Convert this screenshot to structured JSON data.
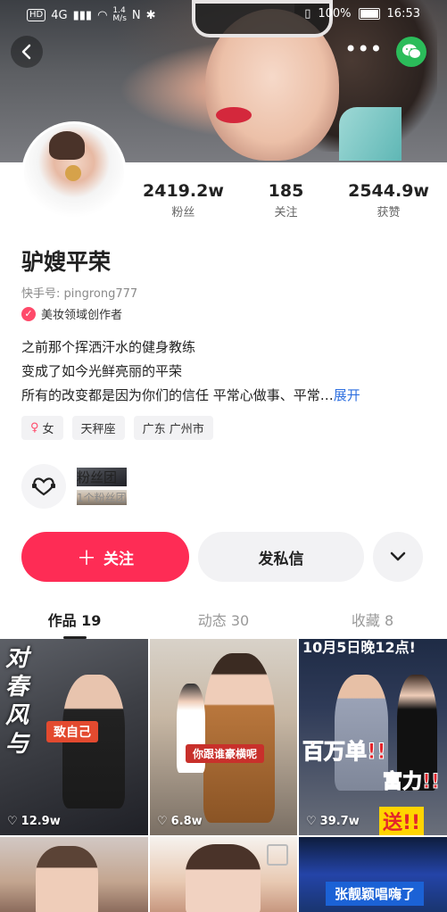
{
  "status_bar": {
    "network": "HD 4G",
    "speed": "1.4\nM/s",
    "battery": "100%",
    "time": "16:53"
  },
  "profile": {
    "name": "驴嫂平荣",
    "kuaishou_id": "快手号: pingrong777",
    "certification": "美妆领域创作者",
    "bio_lines": [
      "之前那个挥洒汗水的健身教练",
      "变成了如今光鲜亮丽的平荣",
      "所有的改变都是因为你们的信任 平常心做事、平常…"
    ],
    "expand_label": "展开",
    "tags": [
      "女",
      "天秤座",
      "广东 广州市"
    ]
  },
  "stats": [
    {
      "value": "2419.2w",
      "label": "粉丝"
    },
    {
      "value": "185",
      "label": "关注"
    },
    {
      "value": "2544.9w",
      "label": "获赞"
    }
  ],
  "fan_group": {
    "title": "粉丝团",
    "subtitle": "1个粉丝团"
  },
  "actions": {
    "follow": "关注",
    "message": "发私信"
  },
  "tabs": [
    {
      "label": "作品 19"
    },
    {
      "label": "动态 30"
    },
    {
      "label": "收藏 8"
    }
  ],
  "videos": [
    {
      "likes": "12.9w",
      "overlay": "致自己",
      "side_text": "对\n春\n风\n与"
    },
    {
      "likes": "6.8w",
      "overlay": "你跟谁豪横呢"
    },
    {
      "likes": "39.7w",
      "overlay": "百万单!!",
      "overlay2": "富力!!",
      "overlay3": "送!!",
      "top_text": "10月5日晚12点!"
    },
    {
      "likes": ""
    },
    {
      "likes": ""
    },
    {
      "likes": "",
      "overlay": "张靓颖唱嗨了"
    }
  ]
}
